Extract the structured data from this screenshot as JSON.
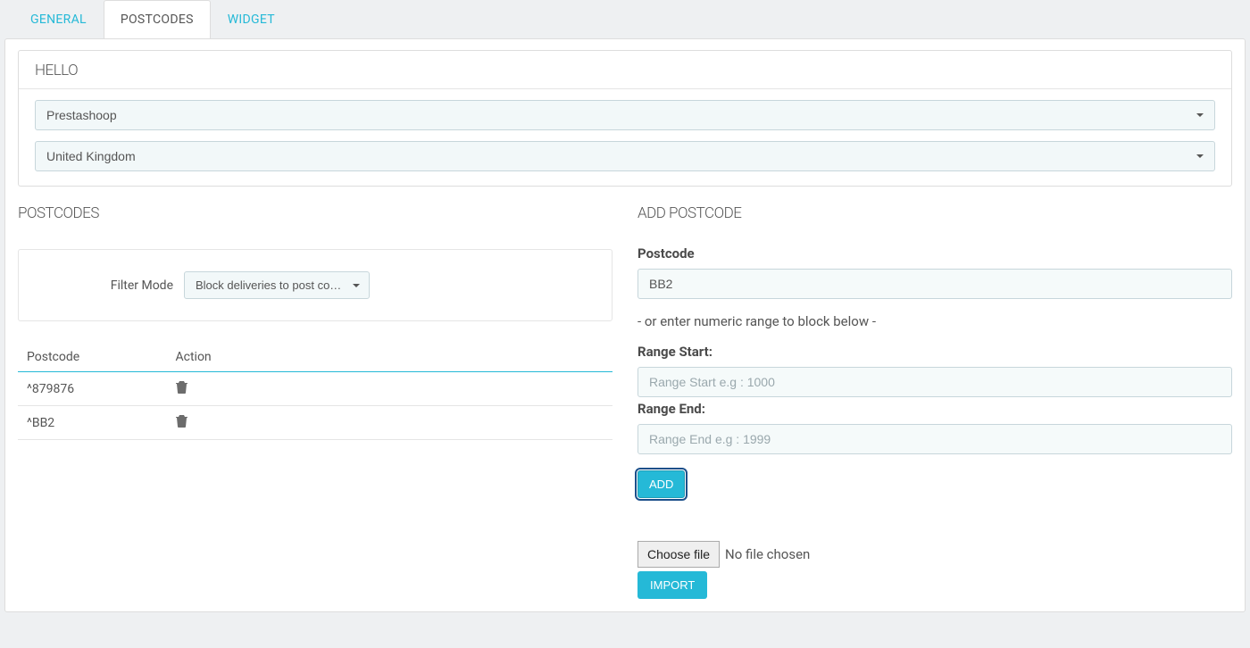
{
  "tabs": {
    "general": "General",
    "postcodes": "Postcodes",
    "widget": "Widget"
  },
  "hello": {
    "heading": "HELLO",
    "carrier_selected": "Prestashoop",
    "country_selected": "United Kingdom"
  },
  "left": {
    "heading": "POSTCODES",
    "filter_label": "Filter Mode",
    "filter_selected": "Block deliveries to post codes",
    "table": {
      "col_postcode": "Postcode",
      "col_action": "Action",
      "rows": [
        {
          "postcode": "^879876"
        },
        {
          "postcode": "^BB2"
        }
      ]
    }
  },
  "right": {
    "heading": "ADD POSTCODE",
    "label_postcode": "Postcode",
    "postcode_value": "BB2",
    "or_text": "- or enter numeric range to block below -",
    "label_range_start": "Range Start:",
    "placeholder_range_start": "Range Start e.g : 1000",
    "label_range_end": "Range End:",
    "placeholder_range_end": "Range End e.g : 1999",
    "add_label": "Add",
    "choose_file_label": "Choose file",
    "file_status": "No file chosen",
    "import_label": "Import"
  }
}
